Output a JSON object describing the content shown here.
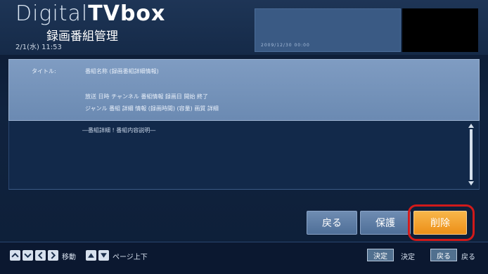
{
  "header": {
    "logo_thin": "Digital",
    "logo_bold": "TVbox",
    "screen_title": "録画番組管理",
    "datetime": "2/1(水) 11:53"
  },
  "preview": {
    "caption": "2009/12/30 00:00"
  },
  "info": {
    "label": "タイトル:",
    "title": "番組名称 (録画番組詳細情報)",
    "meta1": "放送 日時 チャンネル 番組情報 録画日 開始 終了",
    "meta2": "ジャンル 番組 詳細 情報 (録画時間) (容量) 画質 詳細"
  },
  "description": {
    "text": "―番組詳細 ! 番組内容説明―"
  },
  "buttons": {
    "back": "戻る",
    "protect": "保護",
    "delete": "削除"
  },
  "footer": {
    "move_label": "移動",
    "page_label": "ページ上下",
    "decide_key": "決定",
    "decide_label": "決定",
    "back_key": "戻る",
    "back_label": "戻る"
  },
  "colors": {
    "accent_delete": "#ec8f18",
    "highlight_ring": "#d11a1a"
  }
}
